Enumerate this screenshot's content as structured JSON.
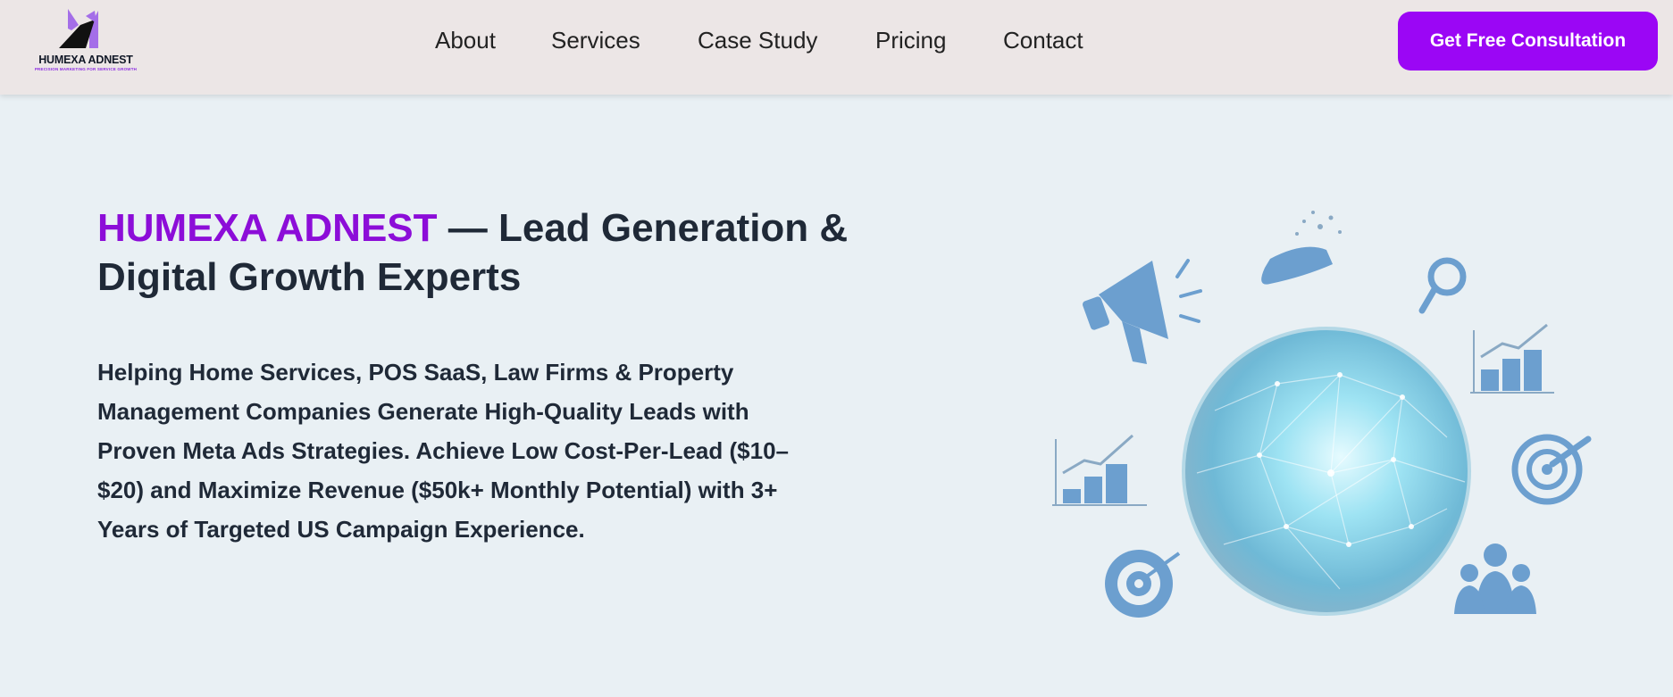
{
  "header": {
    "logo_name": "HUMEXA ADNEST",
    "logo_tagline": "PRECISION MARKETING FOR SERVICE GROWTH",
    "nav": [
      {
        "label": "About"
      },
      {
        "label": "Services"
      },
      {
        "label": "Case Study"
      },
      {
        "label": "Pricing"
      },
      {
        "label": "Contact"
      }
    ],
    "cta_label": "Get Free Consultation"
  },
  "hero": {
    "title_brand": "HUMEXA ADNEST",
    "title_rest": " — Lead Generation & Digital Growth Experts",
    "description": "Helping Home Services, POS SaaS, Law Firms & Property Management Companies Generate High-Quality Leads with Proven Meta Ads Strategies. Achieve Low Cost-Per-Lead ($10–$20) and Maximize Revenue ($50k+ Monthly Potential) with 3+ Years of Targeted US Campaign Experience."
  },
  "illustration": {
    "icons": [
      "megaphone-icon",
      "rocket-icon",
      "magnifier-icon",
      "growth-chart-icon",
      "bar-chart-icon",
      "target-icon",
      "dartboard-icon",
      "people-icon",
      "globe-network"
    ]
  },
  "colors": {
    "accent": "#9b06f5",
    "brand_text": "#8c0dd8",
    "header_bg": "#ece6e6",
    "page_bg": "#e9f0f4",
    "icon_blue": "#6c9fcf"
  }
}
